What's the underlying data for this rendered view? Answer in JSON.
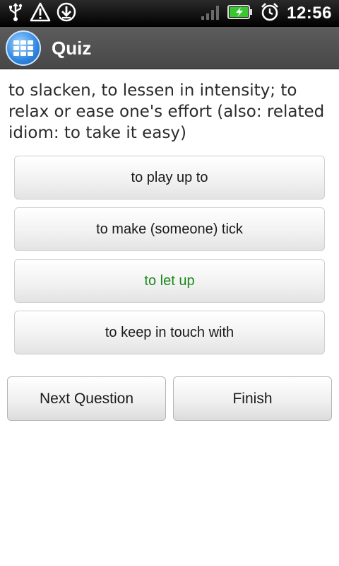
{
  "status_bar": {
    "time": "12:56",
    "icons": [
      "usb-icon",
      "warning-icon",
      "download-icon",
      "signal-icon",
      "battery-icon",
      "alarm-icon"
    ]
  },
  "header": {
    "title": "Quiz",
    "icon": "app-grid-icon"
  },
  "question": {
    "text": "to slacken, to lessen in intensity; to relax or ease one's effort (also: related idiom: to take it easy)"
  },
  "answers": [
    {
      "label": "to play up to"
    },
    {
      "label": "to make (someone) tick"
    },
    {
      "label": "to let up",
      "state": "correct"
    },
    {
      "label": "to keep in touch with"
    }
  ],
  "actions": {
    "next_label": "Next Question",
    "finish_label": "Finish"
  },
  "colors": {
    "correct_answer": "#1a8a1a",
    "title_bar": "#505050"
  }
}
